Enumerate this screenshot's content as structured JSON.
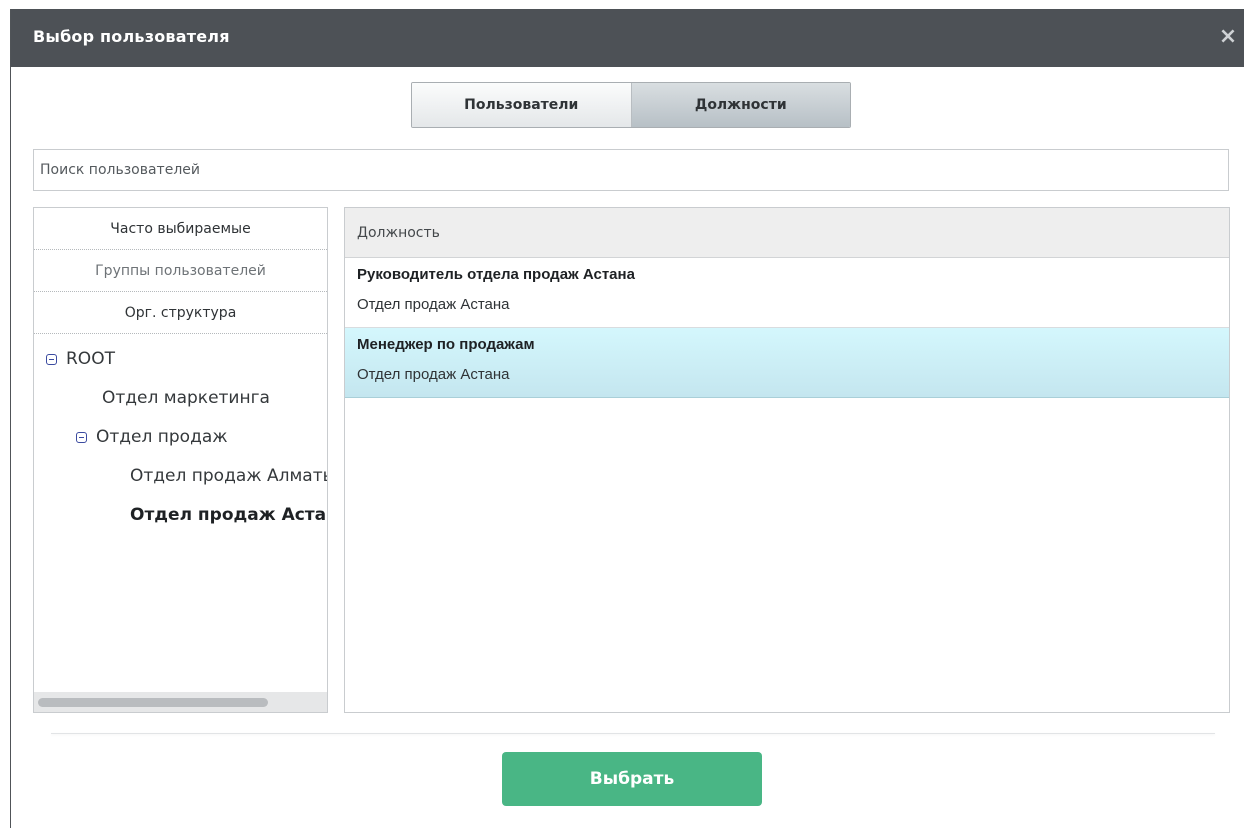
{
  "dialog": {
    "title": "Выбор пользователя",
    "close_symbol": "×"
  },
  "tabs": [
    {
      "label": "Пользователи",
      "active": false
    },
    {
      "label": "Должности",
      "active": true
    }
  ],
  "search": {
    "placeholder": "Поиск пользователей",
    "value": ""
  },
  "left_tabs": [
    {
      "label": "Часто выбираемые"
    },
    {
      "label": "Группы пользователей"
    },
    {
      "label": "Орг. структура"
    }
  ],
  "tree": {
    "root": "ROOT",
    "marketing": "Отдел маркетинга",
    "sales": "Отдел продаж",
    "sales_almaty": "Отдел продаж Алматы",
    "sales_astana": "Отдел продаж Астана"
  },
  "grid": {
    "header": "Должность",
    "rows": [
      {
        "title": "Руководитель отдела продаж Астана",
        "department": "Отдел продаж Астана",
        "selected": false
      },
      {
        "title": "Менеджер по продажам",
        "department": "Отдел продаж Астана",
        "selected": true
      }
    ]
  },
  "footer": {
    "select_label": "Выбрать"
  },
  "colors": {
    "titlebar": "#4d5156",
    "accent_button": "#49b685",
    "selected_row": "#cdeff7",
    "tree_toggle": "#3b4ba0"
  },
  "icons": {
    "close": "close-icon",
    "tree_toggle": "minus-box-icon"
  }
}
